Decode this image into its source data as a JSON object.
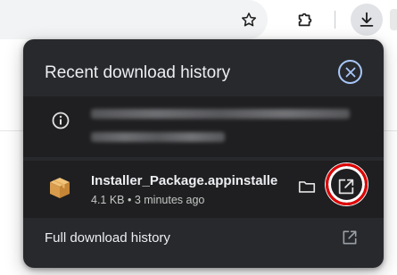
{
  "panel": {
    "title": "Recent download history",
    "full_history_label": "Full download history"
  },
  "downloads": [
    {
      "name": "Installer_Package.appinstalle",
      "meta": "4.1 KB • 3 minutes ago"
    }
  ],
  "icons": {
    "star": "star-icon",
    "extension": "puzzle-piece-icon",
    "download": "download-icon",
    "close": "close-circle-icon",
    "info": "info-icon",
    "package": "package-box-icon",
    "folder": "folder-icon",
    "open": "open-external-icon"
  },
  "colors": {
    "panel_bg": "#28292c",
    "item_bg": "#1f1f21",
    "accent": "#a8c7fa",
    "highlight": "#e00000"
  }
}
